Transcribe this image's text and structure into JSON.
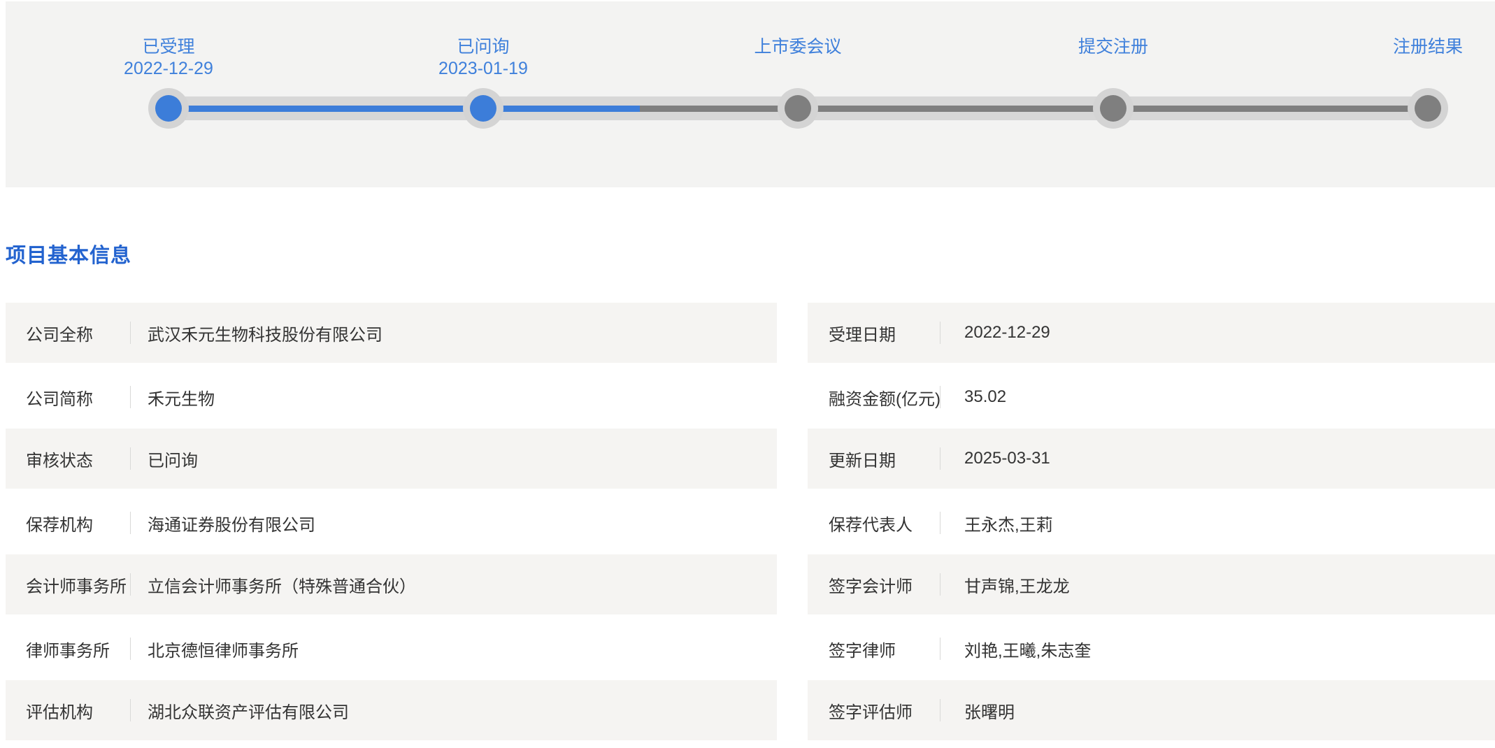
{
  "colors": {
    "accent_blue": "#3c7dd9",
    "step_label_blue": "#3f80db",
    "title_blue": "#2363cf",
    "pending_gray": "#7f7f7f",
    "track_gray": "#d7d7d7",
    "banner_bg": "#f3f3f2",
    "row_band_bg": "#f5f4f2"
  },
  "timeline": {
    "steps": [
      {
        "label": "已受理",
        "date": "2022-12-29",
        "state": "done"
      },
      {
        "label": "已问询",
        "date": "2023-01-19",
        "state": "done"
      },
      {
        "label": "上市委会议",
        "date": "",
        "state": "pending"
      },
      {
        "label": "提交注册",
        "date": "",
        "state": "pending"
      },
      {
        "label": "注册结果",
        "date": "",
        "state": "pending"
      }
    ]
  },
  "section": {
    "title": "项目基本信息"
  },
  "info": {
    "left": [
      {
        "label": "公司全称",
        "value": "武汉禾元生物科技股份有限公司"
      },
      {
        "label": "公司简称",
        "value": "禾元生物"
      },
      {
        "label": "审核状态",
        "value": "已问询"
      },
      {
        "label": "保荐机构",
        "value": "海通证券股份有限公司"
      },
      {
        "label": "会计师事务所",
        "value": "立信会计师事务所（特殊普通合伙）"
      },
      {
        "label": "律师事务所",
        "value": "北京德恒律师事务所"
      },
      {
        "label": "评估机构",
        "value": "湖北众联资产评估有限公司"
      }
    ],
    "right": [
      {
        "label": "受理日期",
        "value": "2022-12-29"
      },
      {
        "label": "融资金额(亿元)",
        "value": "35.02"
      },
      {
        "label": "更新日期",
        "value": "2025-03-31"
      },
      {
        "label": "保荐代表人",
        "value": "王永杰,王莉"
      },
      {
        "label": "签字会计师",
        "value": "甘声锦,王龙龙"
      },
      {
        "label": "签字律师",
        "value": "刘艳,王曦,朱志奎"
      },
      {
        "label": "签字评估师",
        "value": "张曙明"
      }
    ]
  }
}
